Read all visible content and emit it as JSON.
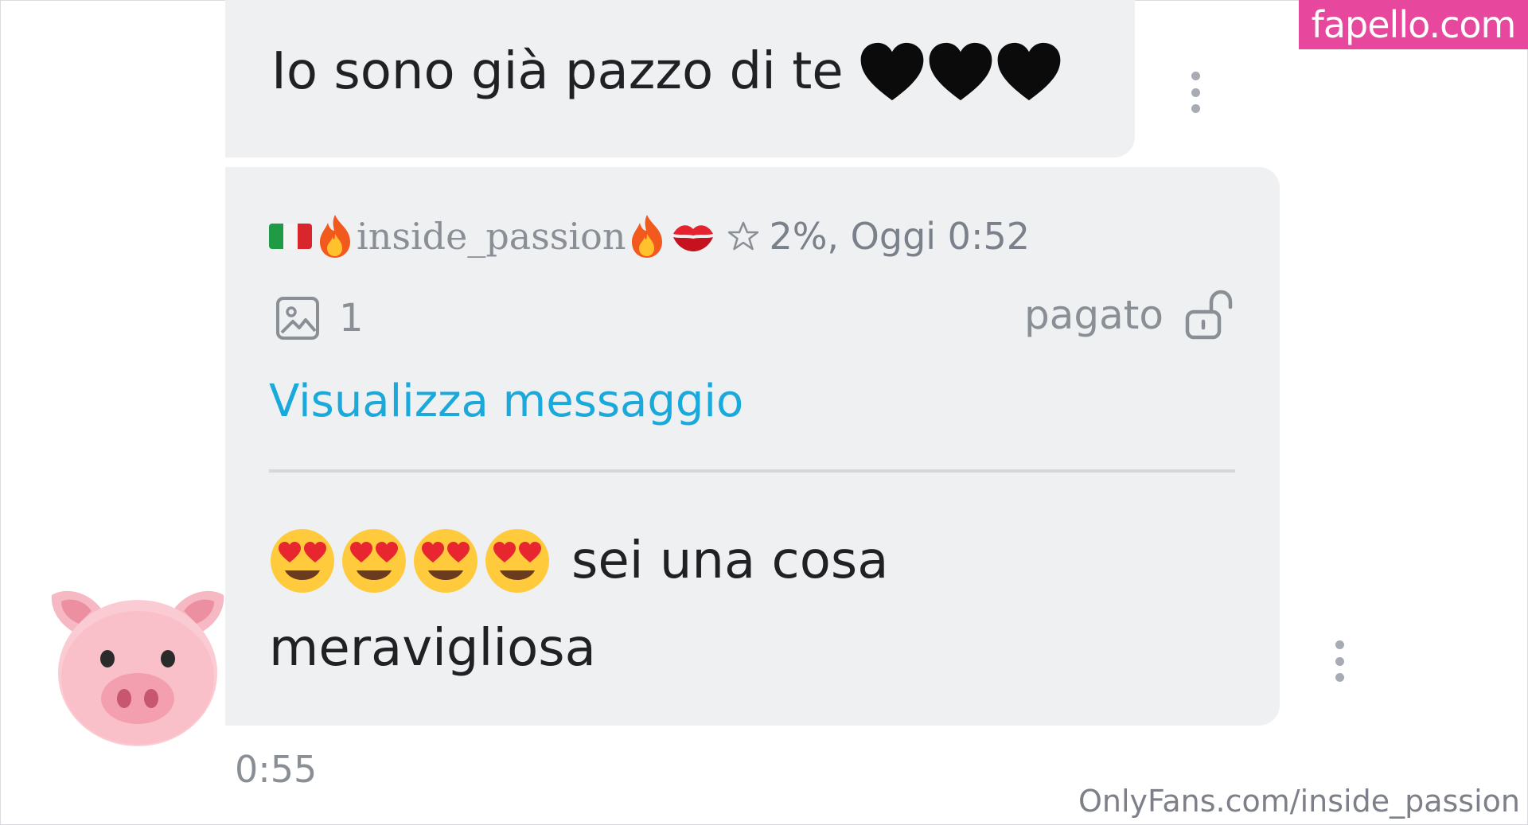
{
  "messages": {
    "previous": {
      "text": "Io sono già pazzo di te",
      "emoji_icons": [
        "black-heart-icon",
        "black-heart-icon",
        "black-heart-icon"
      ]
    },
    "current": {
      "sender": {
        "username": "inside_passion",
        "prefix_icons": [
          "italy-flag-icon",
          "fire-icon"
        ],
        "suffix_icons": [
          "fire-icon",
          "kiss-icon"
        ],
        "meta": "2%, Oggi 0:52",
        "meta_icon": "star-icon"
      },
      "media": {
        "icon": "image-icon",
        "count": "1"
      },
      "paid": {
        "label": "pagato",
        "icon": "unlock-icon"
      },
      "view_link": "Visualizza messaggio",
      "body_line1": "sei una cosa",
      "body_line2": "meravigliosa",
      "body_emoji": [
        "heart-eyes-icon",
        "heart-eyes-icon",
        "heart-eyes-icon",
        "heart-eyes-icon"
      ],
      "timestamp": "0:55"
    }
  },
  "avatar": {
    "icon": "pig-face-icon"
  },
  "watermarks": {
    "top": "fapello.com",
    "bottom": "OnlyFans.com/inside_passion"
  },
  "colors": {
    "bubble": "#eef0f2",
    "link": "#1aa9db",
    "muted": "#8a8f96",
    "watermark_bg": "#e7489e"
  }
}
